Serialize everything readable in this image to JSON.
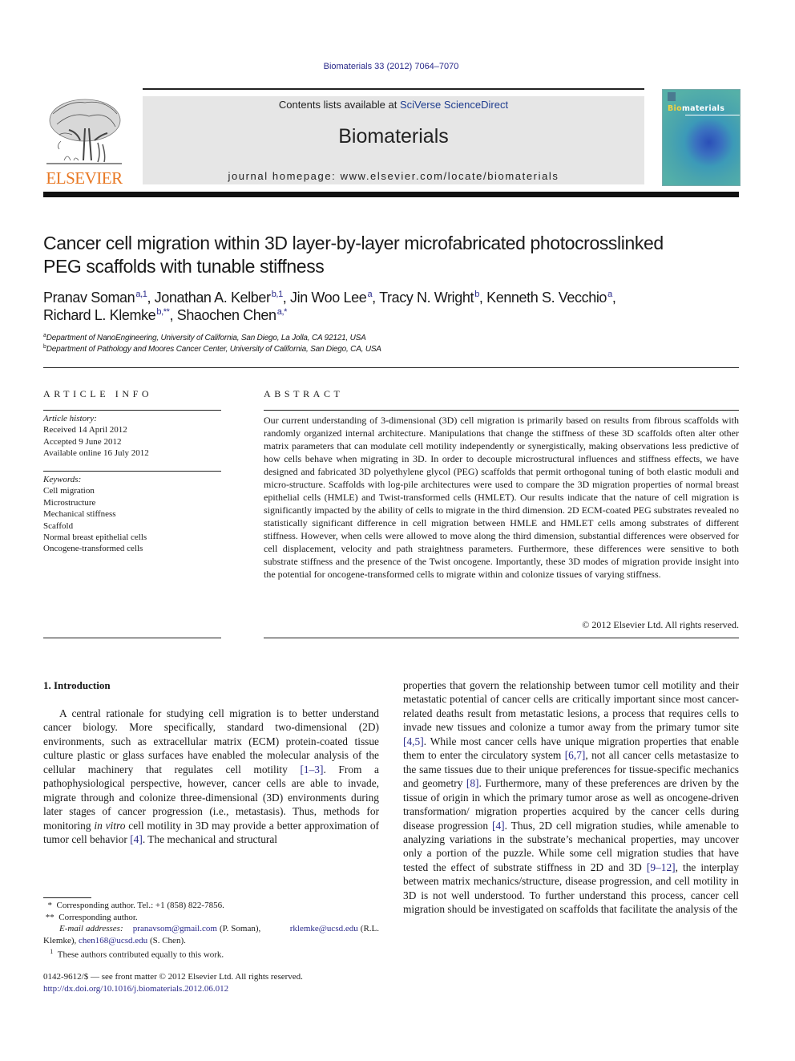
{
  "header": {
    "citation": "Biomaterials 33 (2012) 7064–7070",
    "contents_prefix": "Contents lists available at ",
    "contents_link": "SciVerse ScienceDirect",
    "journal_name": "Biomaterials",
    "homepage": "journal homepage: www.elsevier.com/locate/biomaterials",
    "publisher_logo_text": "ELSEVIER",
    "cover": {
      "title_highlight": "Bio",
      "title_rest": "materials"
    }
  },
  "article": {
    "title_line1": "Cancer cell migration within 3D layer-by-layer microfabricated photocrosslinked",
    "title_line2": "PEG scaffolds with tunable stiffness",
    "authors": [
      {
        "name": "Pranav Soman",
        "sup": "a,1",
        "sep": ", "
      },
      {
        "name": "Jonathan A. Kelber",
        "sup": "b,1",
        "sep": ", "
      },
      {
        "name": "Jin Woo Lee",
        "sup": "a",
        "sep": ", "
      },
      {
        "name": "Tracy N. Wright",
        "sup": "b",
        "sep": ", "
      },
      {
        "name": "Kenneth S. Vecchio",
        "sup": "a",
        "sep": ","
      },
      {
        "name": "Richard L. Klemke",
        "sup": "b,**",
        "sep": ", "
      },
      {
        "name": "Shaochen Chen",
        "sup": "a,*",
        "sep": ""
      }
    ],
    "affiliations": [
      {
        "mark": "a",
        "text": "Department of NanoEngineering, University of California, San Diego, La Jolla, CA 92121, USA"
      },
      {
        "mark": "b",
        "text": "Department of Pathology and Moores Cancer Center, University of California, San Diego, CA, USA"
      }
    ]
  },
  "article_info": {
    "heading": "ARTICLE INFO",
    "history_label": "Article history:",
    "history": [
      "Received 14 April 2012",
      "Accepted 9 June 2012",
      "Available online 16 July 2012"
    ],
    "keywords_label": "Keywords:",
    "keywords": [
      "Cell migration",
      "Microstructure",
      "Mechanical stiffness",
      "Scaffold",
      "Normal breast epithelial cells",
      "Oncogene-transformed cells"
    ]
  },
  "abstract": {
    "heading": "ABSTRACT",
    "text": "Our current understanding of 3-dimensional (3D) cell migration is primarily based on results from fibrous scaffolds with randomly organized internal architecture. Manipulations that change the stiffness of these 3D scaffolds often alter other matrix parameters that can modulate cell motility independently or synergistically, making observations less predictive of how cells behave when migrating in 3D. In order to decouple microstructural influences and stiffness effects, we have designed and fabricated 3D polyethylene glycol (PEG) scaffolds that permit orthogonal tuning of both elastic moduli and micro-structure. Scaffolds with log-pile architectures were used to compare the 3D migration properties of normal breast epithelial cells (HMLE) and Twist-transformed cells (HMLET). Our results indicate that the nature of cell migration is significantly impacted by the ability of cells to migrate in the third dimension. 2D ECM-coated PEG substrates revealed no statistically significant difference in cell migration between HMLE and HMLET cells among substrates of different stiffness. However, when cells were allowed to move along the third dimension, substantial differences were observed for cell displacement, velocity and path straightness parameters. Furthermore, these differences were sensitive to both substrate stiffness and the presence of the Twist oncogene. Importantly, these 3D modes of migration provide insight into the potential for oncogene-transformed cells to migrate within and colonize tissues of varying stiffness.",
    "copyright": "© 2012 Elsevier Ltd. All rights reserved."
  },
  "introduction": {
    "heading": "1.  Introduction",
    "col1": [
      {
        "t": "A central rationale for studying cell migration is to better understand cancer biology. More specifically, standard two-dimensional (2D) environments, such as extracellular matrix (ECM) protein-coated tissue culture plastic or glass surfaces have enabled the molecular analysis of the cellular machinery that regulates cell motility "
      },
      {
        "ref": "[1–3]"
      },
      {
        "t": ". From a pathophysiological perspective, however, cancer cells are able to invade, migrate through and colonize three-dimensional (3D) environments during later stages of cancer progression (i.e., metastasis). Thus, methods for monitoring "
      },
      {
        "it": "in vitro"
      },
      {
        "t": " cell motility in 3D may provide a better approximation of tumor cell behavior "
      },
      {
        "ref": "[4]"
      },
      {
        "t": ". The mechanical and structural"
      }
    ],
    "col2": [
      {
        "t": "properties that govern the relationship between tumor cell motility and their metastatic potential of cancer cells are critically important since most cancer-related deaths result from metastatic lesions, a process that requires cells to invade new tissues and colonize a tumor away from the primary tumor site "
      },
      {
        "ref": "[4,5]"
      },
      {
        "t": ". While most cancer cells have unique migration properties that enable them to enter the circulatory system "
      },
      {
        "ref": "[6,7]"
      },
      {
        "t": ", not all cancer cells metastasize to the same tissues due to their unique preferences for tissue-specific mechanics and geometry "
      },
      {
        "ref": "[8]"
      },
      {
        "t": ". Furthermore, many of these preferences are driven by the tissue of origin in which the primary tumor arose as well as oncogene-driven transformation/ migration properties acquired by the cancer cells during disease progression "
      },
      {
        "ref": "[4]"
      },
      {
        "t": ". Thus, 2D cell migration studies, while amenable to analyzing variations in the substrate’s mechanical properties, may uncover only a portion of the puzzle. While some cell migration studies that have tested the effect of substrate stiffness in 2D and 3D "
      },
      {
        "ref": "[9–12]"
      },
      {
        "t": ", the interplay between matrix mechanics/structure, disease progression, and cell motility in 3D is not well understood. To further understand this process, cancer cell migration should be investigated on scaffolds that facilitate the analysis of the"
      }
    ]
  },
  "footnotes": {
    "fn1_mark": "*",
    "fn1_text": "Corresponding author. Tel.: +1 (858) 822-7856.",
    "fn2_mark": "**",
    "fn2_text": "Corresponding author.",
    "email_label": "E-mail addresses:",
    "email1": "pranavsom@gmail.com",
    "email1_owner": " (P. Soman), ",
    "email2": "rklemke@ucsd.edu",
    "email2_owner": "(R.L. Klemke), ",
    "email3": "chen168@ucsd.edu",
    "email3_owner": " (S. Chen).",
    "fn3_mark": "1",
    "fn3_text": "These authors contributed equally to this work.",
    "issn": "0142-9612/$ — see front matter © 2012 Elsevier Ltd. All rights reserved.",
    "doi": "http://dx.doi.org/10.1016/j.biomaterials.2012.06.012"
  }
}
